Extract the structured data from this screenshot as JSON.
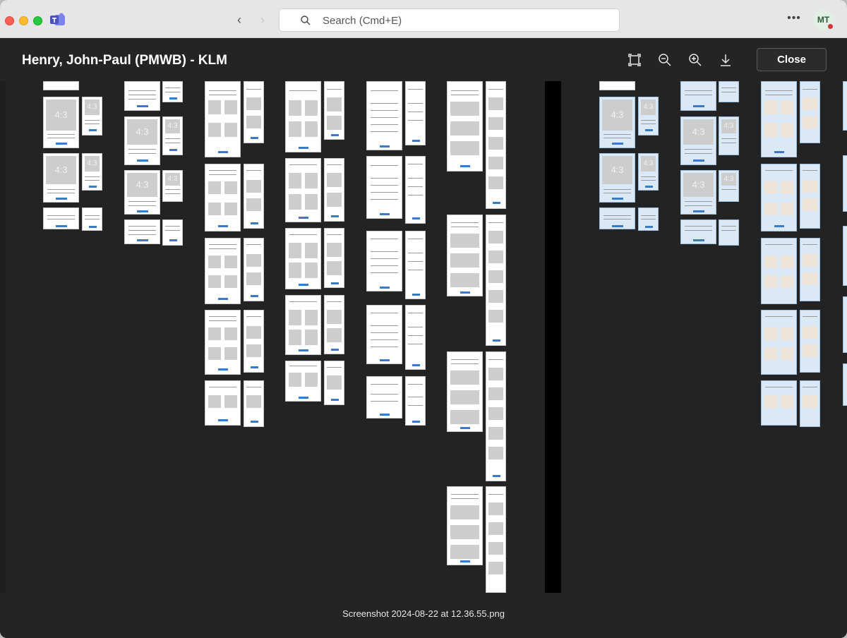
{
  "app": {
    "name": "Microsoft Teams"
  },
  "search": {
    "placeholder": "Search (Cmd+E)"
  },
  "user": {
    "initials": "MT"
  },
  "viewer": {
    "title": "Henry, John-Paul (PMWB) - KLM",
    "close_label": "Close",
    "filename": "Screenshot 2024-08-22 at 12.36.55.png",
    "tools": [
      "fit-to-screen-icon",
      "zoom-out-icon",
      "zoom-in-icon",
      "download-icon"
    ]
  },
  "thumb_text": {
    "ratio": "4:3"
  }
}
